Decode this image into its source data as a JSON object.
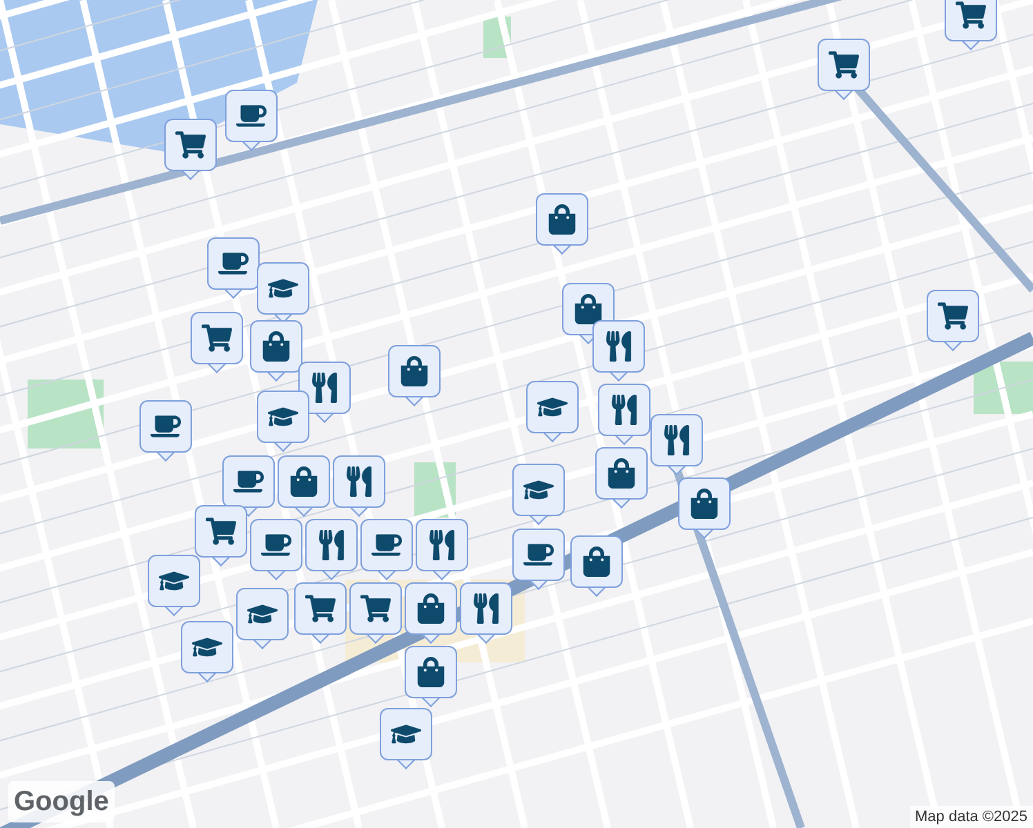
{
  "map": {
    "pins": [
      {
        "kind": "cart"
      },
      {
        "kind": "cart"
      },
      {
        "kind": "coffee"
      },
      {
        "kind": "cart"
      },
      {
        "kind": "bag"
      },
      {
        "kind": "coffee"
      },
      {
        "kind": "grad"
      },
      {
        "kind": "cart"
      },
      {
        "kind": "bag"
      },
      {
        "kind": "bag"
      },
      {
        "kind": "bag"
      },
      {
        "kind": "dining"
      },
      {
        "kind": "grad"
      },
      {
        "kind": "dining"
      },
      {
        "kind": "dining"
      },
      {
        "kind": "coffee"
      },
      {
        "kind": "grad"
      },
      {
        "kind": "coffee"
      },
      {
        "kind": "bag"
      },
      {
        "kind": "dining"
      },
      {
        "kind": "dining"
      },
      {
        "kind": "coffee"
      },
      {
        "kind": "dining"
      },
      {
        "kind": "cart"
      },
      {
        "kind": "coffee"
      },
      {
        "kind": "dining"
      },
      {
        "kind": "bag"
      },
      {
        "kind": "bag"
      },
      {
        "kind": "grad"
      },
      {
        "kind": "grad"
      },
      {
        "kind": "coffee"
      },
      {
        "kind": "bag"
      },
      {
        "kind": "cart"
      },
      {
        "kind": "cart"
      },
      {
        "kind": "dining"
      },
      {
        "kind": "bag"
      },
      {
        "kind": "bag"
      },
      {
        "kind": "grad"
      },
      {
        "kind": "grad"
      },
      {
        "kind": "grad"
      },
      {
        "kind": "cart"
      }
    ],
    "logo": "Google",
    "attribution": "Map data ©2025"
  }
}
